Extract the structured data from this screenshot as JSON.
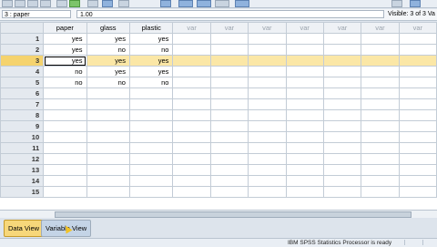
{
  "toolbar": {
    "icons": [
      "open-icon",
      "save-icon",
      "print-icon",
      "dialog-icon",
      "undo-icon",
      "redo-icon",
      "goto-icon",
      "variables-icon",
      "find-icon",
      "insert-icon",
      "split-icon",
      "weight-icon",
      "select-icon",
      "value-labels-icon",
      "sets-icon",
      "spell-icon"
    ]
  },
  "editor": {
    "cell_name": "3 : paper",
    "cell_value": "1.00",
    "visible_text": "Visible: 3 of 3 Va"
  },
  "grid": {
    "columns": [
      "paper",
      "glass",
      "plastic",
      "var",
      "var",
      "var",
      "var",
      "var",
      "var",
      "var"
    ],
    "rows": [
      {
        "num": "1",
        "cells": [
          "yes",
          "yes",
          "yes"
        ]
      },
      {
        "num": "2",
        "cells": [
          "yes",
          "no",
          "no"
        ]
      },
      {
        "num": "3",
        "cells": [
          "yes",
          "yes",
          "yes"
        ]
      },
      {
        "num": "4",
        "cells": [
          "no",
          "yes",
          "yes"
        ]
      },
      {
        "num": "5",
        "cells": [
          "no",
          "no",
          "no"
        ]
      },
      {
        "num": "6",
        "cells": [
          "",
          "",
          ""
        ]
      },
      {
        "num": "7",
        "cells": [
          "",
          "",
          ""
        ]
      },
      {
        "num": "8",
        "cells": [
          "",
          "",
          ""
        ]
      },
      {
        "num": "9",
        "cells": [
          "",
          "",
          ""
        ]
      },
      {
        "num": "10",
        "cells": [
          "",
          "",
          ""
        ]
      },
      {
        "num": "11",
        "cells": [
          "",
          "",
          ""
        ]
      },
      {
        "num": "12",
        "cells": [
          "",
          "",
          ""
        ]
      },
      {
        "num": "13",
        "cells": [
          "",
          "",
          ""
        ]
      },
      {
        "num": "14",
        "cells": [
          "",
          "",
          ""
        ]
      },
      {
        "num": "15",
        "cells": [
          "",
          "",
          ""
        ]
      }
    ],
    "selected_row": "3"
  },
  "tabs": {
    "data_view": "Data View",
    "variable_view": "Variable View"
  },
  "status": {
    "text": "IBM SPSS Statistics Processor is ready"
  }
}
